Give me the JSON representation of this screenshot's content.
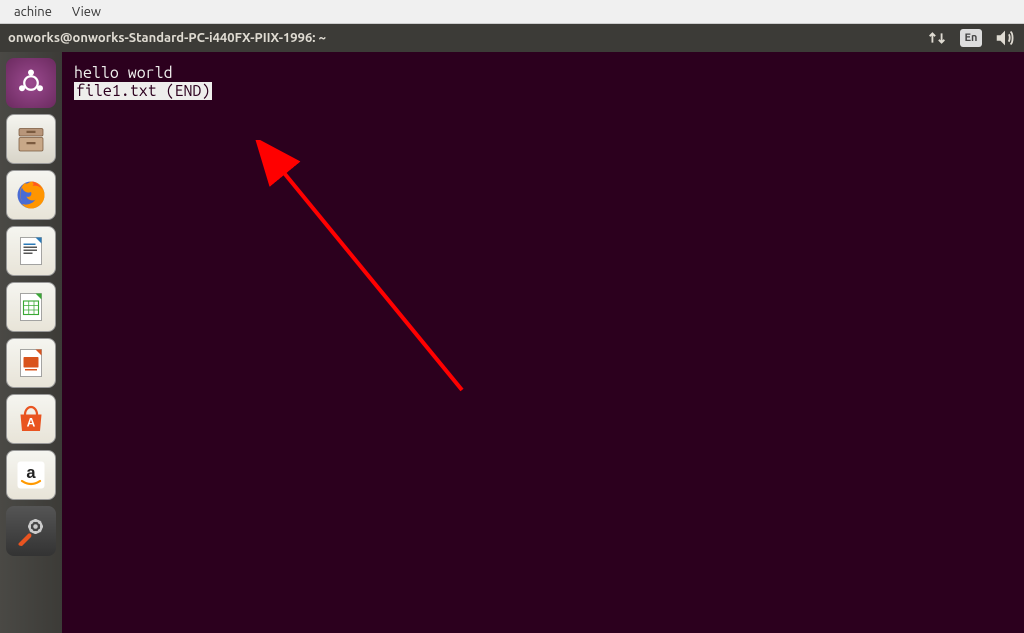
{
  "menubar": {
    "items": [
      "achine",
      "View"
    ]
  },
  "titlebar": {
    "title": "onworks@onworks-Standard-PC-i440FX-PIIX-1996: ~",
    "lang_indicator": "En"
  },
  "launcher": {
    "items": [
      {
        "name": "ubuntu-dash"
      },
      {
        "name": "files"
      },
      {
        "name": "firefox"
      },
      {
        "name": "libreoffice-writer"
      },
      {
        "name": "libreoffice-calc"
      },
      {
        "name": "libreoffice-impress"
      },
      {
        "name": "ubuntu-software"
      },
      {
        "name": "amazon"
      },
      {
        "name": "system-settings"
      }
    ]
  },
  "terminal": {
    "line1": "hello world",
    "line2": "file1.txt (END)"
  }
}
